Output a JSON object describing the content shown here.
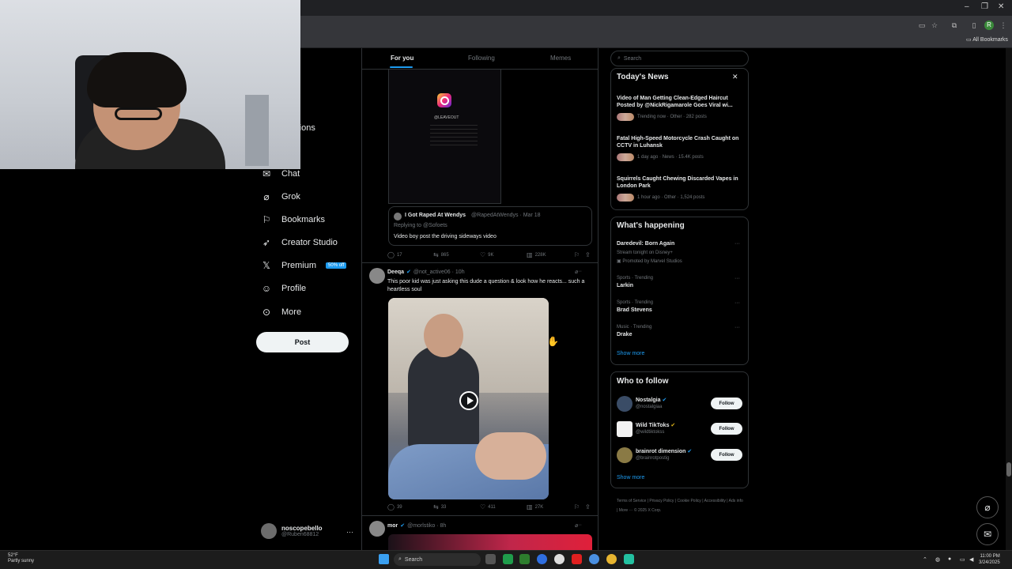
{
  "browser": {
    "window_controls": [
      "–",
      "❐",
      "✕"
    ],
    "all_bookmarks": "All Bookmarks",
    "profile_initial": "R"
  },
  "sidebar": {
    "partial_items": [
      "e",
      "re",
      "cations",
      "w"
    ],
    "items": [
      {
        "label": "Chat",
        "icon": "mail-icon"
      },
      {
        "label": "Grok",
        "icon": "grok-icon"
      },
      {
        "label": "Bookmarks",
        "icon": "bookmark-icon"
      },
      {
        "label": "Creator Studio",
        "icon": "rocket-icon"
      },
      {
        "label": "Premium",
        "icon": "x-logo-icon"
      },
      {
        "label": "Profile",
        "icon": "person-icon"
      },
      {
        "label": "More",
        "icon": "more-circle-icon"
      }
    ],
    "premium_badge": "50% off",
    "post_button": "Post",
    "account": {
      "name": "noscopebello",
      "handle": "@Ruben68812",
      "more": "···"
    }
  },
  "feed": {
    "tabs": [
      "For you",
      "Following",
      "Memes"
    ],
    "active_tab": "For you",
    "quoted_media_account": "@LEAVEOUT",
    "quote": {
      "name": "I Got Raped At Wendys",
      "handle": "@RapedAtWendys · Mar 18",
      "replying": "Replying to @Sofoets",
      "text": "Video boy post the driving sideways video"
    },
    "tweet1_actions": {
      "replies": "17",
      "reposts": "865",
      "likes": "9K",
      "views": "228K"
    },
    "tweet2": {
      "name": "Deeqa",
      "handle": "@not_active06 · 10h",
      "text": "This poor kid was just asking this dude a question & look how he reacts... such a heartless soul",
      "actions": {
        "replies": "39",
        "reposts": "33",
        "likes": "411",
        "views": "27K"
      }
    },
    "tweet3": {
      "name": "mor",
      "handle": "@morlstiko · 8h"
    }
  },
  "right": {
    "search_placeholder": "Search",
    "todays_news": {
      "title": "Today's News",
      "items": [
        {
          "title": "Video of Man Getting Clean-Edged Haircut Posted by @NickRigamarole Goes Viral wi...",
          "meta": "Trending now · Other · 282 posts"
        },
        {
          "title": "Fatal High-Speed Motorcycle Crash Caught on CCTV in Luhansk",
          "meta": "1 day ago · News · 15.4K posts"
        },
        {
          "title": "Squirrels Caught Chewing Discarded Vapes in London Park",
          "meta": "1 hour ago · Other · 1,524 posts"
        }
      ]
    },
    "whats_happening": {
      "title": "What's happening",
      "items": [
        {
          "category": "",
          "name": "Daredevil: Born Again",
          "sub": "Stream tonight on Disney+",
          "sub2": "Promoted by Marvel Studios"
        },
        {
          "category": "Sports · Trending",
          "name": "Larkin"
        },
        {
          "category": "Sports · Trending",
          "name": "Brad Stevens"
        },
        {
          "category": "Music · Trending",
          "name": "Drake"
        }
      ],
      "show_more": "Show more"
    },
    "who_to_follow": {
      "title": "Who to follow",
      "accounts": [
        {
          "name": "Nostalgia",
          "handle": "@nostalgiaa",
          "button": "Follow"
        },
        {
          "name": "Wild TikToks",
          "handle": "@wildtiktokss",
          "button": "Follow"
        },
        {
          "name": "brainrot dimension",
          "handle": "@brainrotpostig",
          "button": "Follow"
        }
      ],
      "show_more": "Show more"
    },
    "footer": [
      "Terms of Service",
      "Privacy Policy",
      "Cookie Policy",
      "Accessibility",
      "Ads info",
      "More ···",
      "© 2025 X Corp."
    ]
  },
  "taskbar": {
    "weather_temp": "52°F",
    "weather_desc": "Partly sunny",
    "search": "Search",
    "time": "11:00 PM",
    "date": "3/24/2025"
  }
}
